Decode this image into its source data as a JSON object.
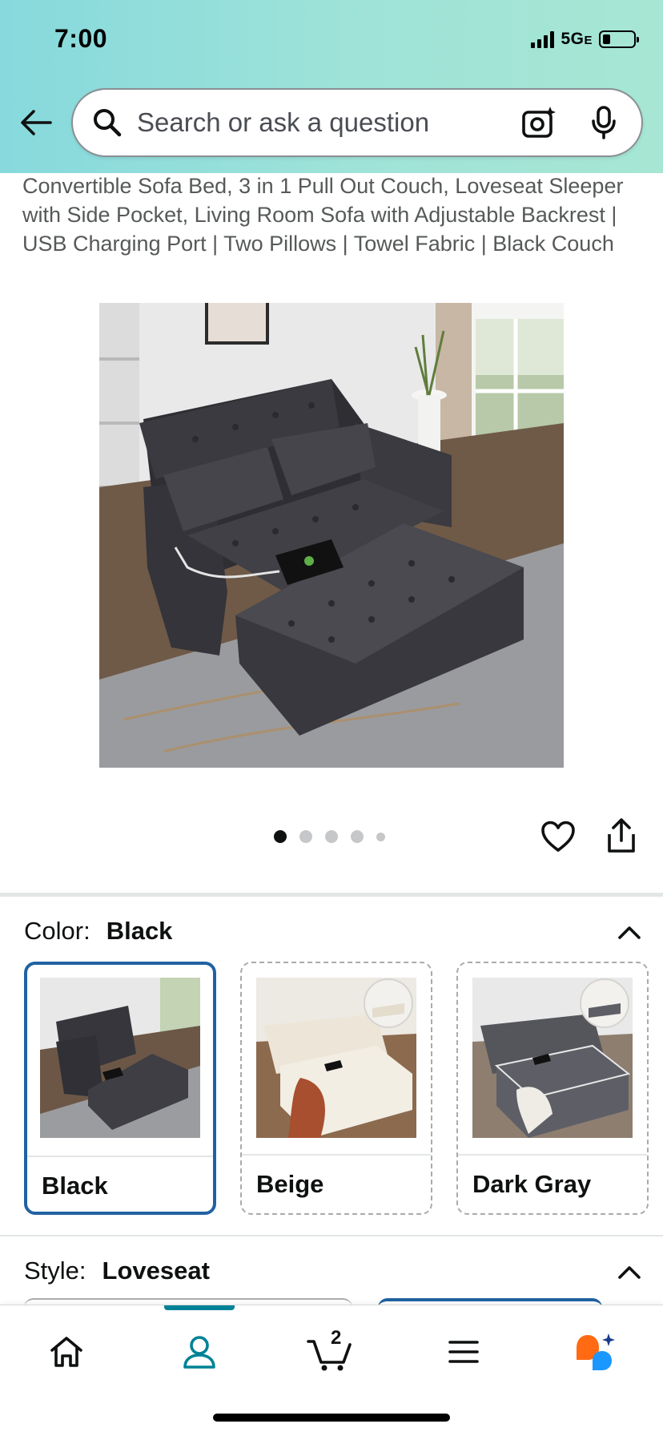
{
  "status_bar": {
    "time": "7:00",
    "network": "5G",
    "network_suffix": "E"
  },
  "search": {
    "placeholder": "Search or ask a question"
  },
  "product": {
    "title": "Convertible Sofa Bed, 3 in 1 Pull Out Couch, Loveseat Sleeper with Side Pocket, Living Room Sofa with Adjustable Backrest | USB Charging Port | Two Pillows | Towel Fabric | Black Couch",
    "image_count": 5,
    "active_image_index": 0
  },
  "color_section": {
    "label": "Color:",
    "selected": "Black",
    "options": [
      {
        "name": "Black",
        "selected": true
      },
      {
        "name": "Beige",
        "selected": false
      },
      {
        "name": "Dark Gray",
        "selected": false
      }
    ]
  },
  "style_section": {
    "label": "Style:",
    "selected": "Loveseat"
  },
  "nav": {
    "items": [
      "home-icon",
      "account-icon",
      "cart-icon",
      "menu-icon",
      "rufus-icon"
    ],
    "active": "account-icon",
    "cart_count": "2"
  },
  "colors": {
    "accent": "#2162a1",
    "teal": "#008296",
    "header_from": "#87d9dd",
    "header_to": "#a6e6d3"
  }
}
